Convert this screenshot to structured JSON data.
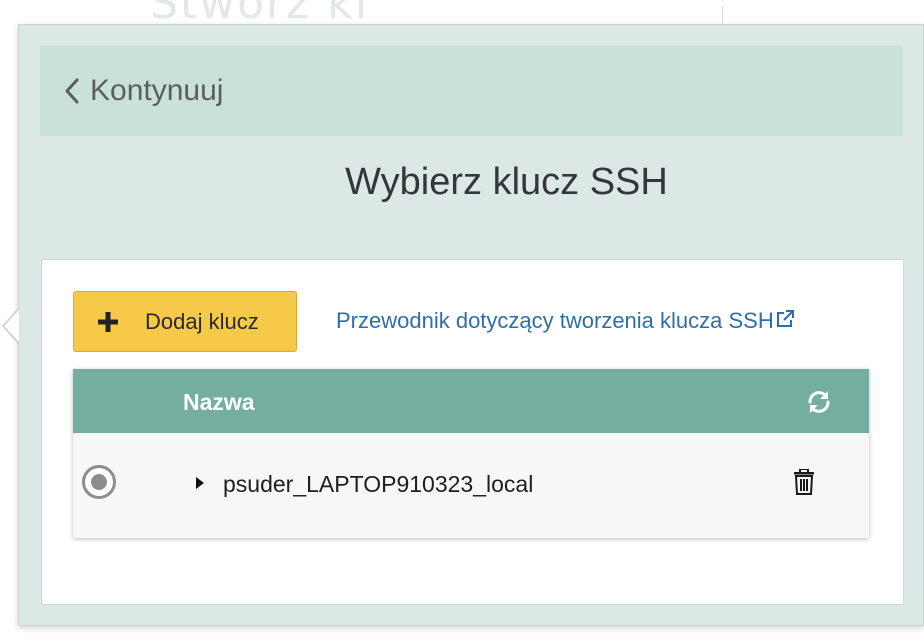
{
  "background": {
    "title_fragment": "Stwórz kl"
  },
  "popover": {
    "back_label": "Kontynuuj",
    "title": "Wybierz klucz SSH",
    "add_key_label": "Dodaj klucz",
    "guide_link_label": "Przewodnik dotyczący tworzenia klucza SSH",
    "table": {
      "column_name": "Nazwa",
      "rows": [
        {
          "name": "psuder_LAPTOP910323_local",
          "selected": false
        }
      ]
    }
  },
  "colors": {
    "popover_bg": "#dbe8e5",
    "back_bar_bg": "#c9e0db",
    "table_header_bg": "#74aea0",
    "add_button_bg": "#f7c948",
    "link": "#2e6fab"
  },
  "icons": {
    "back": "chevron-left-icon",
    "add": "plus-icon",
    "external": "external-link-icon",
    "refresh": "refresh-icon",
    "expand": "caret-right-icon",
    "delete": "trash-icon"
  }
}
